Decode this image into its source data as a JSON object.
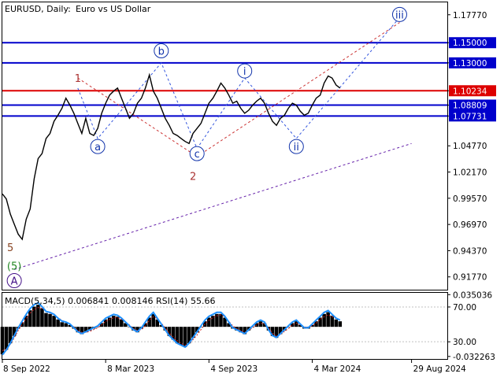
{
  "header": {
    "symbol": "EURUSD, Daily:",
    "description": "Euro vs US Dollar"
  },
  "chart_data": {
    "type": "line",
    "price_axis": {
      "ticks": [
        "1.17770",
        "1.15000",
        "1.13000",
        "1.10234",
        "1.08809",
        "1.07731",
        "1.04770",
        "1.02170",
        "0.99570",
        "0.96970",
        "0.94370",
        "0.91770"
      ],
      "tick_values": [
        1.1777,
        1.15,
        1.13,
        1.10234,
        1.08809,
        1.07731,
        1.0477,
        1.0217,
        0.9957,
        0.9697,
        0.9437,
        0.9177
      ],
      "ylim": [
        0.905,
        1.19
      ]
    },
    "levels": [
      {
        "label": "1.15000",
        "value": 1.15,
        "color": "#0000cc"
      },
      {
        "label": "1.13000",
        "value": 1.13,
        "color": "#0000cc"
      },
      {
        "label": "1.10234",
        "value": 1.10234,
        "color": "#dd0000"
      },
      {
        "label": "1.08809",
        "value": 1.08809,
        "color": "#0000cc"
      },
      {
        "label": "1.07731",
        "value": 1.07731,
        "color": "#0000cc"
      }
    ],
    "current_price": "1.10234",
    "time_axis": {
      "labels": [
        "8 Sep 2022",
        "8 Mar 2023",
        "4 Sep 2023",
        "4 Mar 2024",
        "29 Aug 2024"
      ],
      "label_index": [
        0,
        26,
        52,
        78,
        103
      ],
      "range_index": [
        0,
        112
      ]
    },
    "price_series": {
      "note_units": "weekly close approximations, index = weeks since 8 Sep 2022",
      "values": [
        1.0,
        0.995,
        0.98,
        0.97,
        0.96,
        0.955,
        0.975,
        0.985,
        1.015,
        1.035,
        1.04,
        1.055,
        1.06,
        1.072,
        1.078,
        1.085,
        1.095,
        1.088,
        1.08,
        1.07,
        1.06,
        1.075,
        1.06,
        1.058,
        1.065,
        1.08,
        1.09,
        1.098,
        1.102,
        1.105,
        1.095,
        1.085,
        1.075,
        1.08,
        1.09,
        1.095,
        1.105,
        1.118,
        1.102,
        1.095,
        1.085,
        1.075,
        1.068,
        1.06,
        1.058,
        1.055,
        1.052,
        1.05,
        1.06,
        1.065,
        1.07,
        1.08,
        1.09,
        1.095,
        1.102,
        1.11,
        1.105,
        1.098,
        1.09,
        1.092,
        1.085,
        1.08,
        1.083,
        1.088,
        1.092,
        1.095,
        1.09,
        1.08,
        1.072,
        1.068,
        1.075,
        1.078,
        1.085,
        1.09,
        1.088,
        1.082,
        1.078,
        1.08,
        1.088,
        1.095,
        1.098,
        1.11,
        1.117,
        1.115,
        1.108,
        1.105
      ]
    },
    "wave_labels": [
      {
        "text": "1",
        "x": 19,
        "y": 1.115,
        "color": "#aa3333",
        "circle": false
      },
      {
        "text": "2",
        "x": 48,
        "y": 1.018,
        "color": "#aa3333",
        "circle": false
      },
      {
        "text": "5",
        "x": 2,
        "y": 0.947,
        "color": "#884422",
        "circle": false
      },
      {
        "text": "(5)",
        "x": 3,
        "y": 0.929,
        "color": "#228822",
        "circle": false
      },
      {
        "text": "A",
        "x": 3,
        "y": 0.914,
        "color": "#441188",
        "circle": true
      },
      {
        "text": "a",
        "x": 24,
        "y": 1.047,
        "color": "#1133aa",
        "circle": true
      },
      {
        "text": "b",
        "x": 40,
        "y": 1.142,
        "color": "#1133aa",
        "circle": true
      },
      {
        "text": "c",
        "x": 49,
        "y": 1.04,
        "color": "#1133aa",
        "circle": true
      },
      {
        "text": "i",
        "x": 61,
        "y": 1.122,
        "color": "#1133aa",
        "circle": true
      },
      {
        "text": "ii",
        "x": 74,
        "y": 1.047,
        "color": "#1133aa",
        "circle": true
      },
      {
        "text": "iii",
        "x": 100,
        "y": 1.178,
        "color": "#1133aa",
        "circle": true
      }
    ],
    "wave_lines": [
      {
        "points": [
          [
            19,
            1.115
          ],
          [
            49,
            1.037
          ]
        ],
        "color": "#cc3333",
        "dash": true
      },
      {
        "points": [
          [
            49,
            1.037
          ],
          [
            100,
            1.17
          ]
        ],
        "color": "#cc3333",
        "dash": true
      },
      {
        "points": [
          [
            19,
            1.105
          ],
          [
            24,
            1.055
          ],
          [
            40,
            1.13
          ],
          [
            49,
            1.045
          ],
          [
            61,
            1.115
          ],
          [
            74,
            1.055
          ],
          [
            100,
            1.175
          ]
        ],
        "color": "#3355dd",
        "dash": true
      },
      {
        "points": [
          [
            3,
            0.925
          ],
          [
            103,
            1.05
          ]
        ],
        "color": "#6622aa",
        "dash": true
      }
    ]
  },
  "indicator": {
    "title": "MACD(5,34,5) 0.006841 0.008146 RSI(14) 55.66",
    "ticks": [
      "0.035036",
      "70.00",
      "30.00",
      "-0.032263"
    ],
    "ylim": [
      -0.035,
      0.037
    ],
    "histogram": [
      -0.03,
      -0.025,
      -0.018,
      -0.01,
      -0.002,
      0.005,
      0.012,
      0.018,
      0.022,
      0.024,
      0.02,
      0.015,
      0.014,
      0.012,
      0.008,
      0.005,
      0.004,
      0.002,
      -0.002,
      -0.006,
      -0.008,
      -0.006,
      -0.004,
      -0.002,
      0.0,
      0.004,
      0.008,
      0.01,
      0.012,
      0.011,
      0.008,
      0.004,
      0.0,
      -0.004,
      -0.006,
      -0.002,
      0.004,
      0.01,
      0.014,
      0.008,
      0.002,
      -0.004,
      -0.01,
      -0.014,
      -0.018,
      -0.02,
      -0.022,
      -0.018,
      -0.012,
      -0.006,
      0.0,
      0.006,
      0.01,
      0.012,
      0.014,
      0.014,
      0.01,
      0.004,
      -0.002,
      -0.004,
      -0.006,
      -0.008,
      -0.004,
      0.0,
      0.004,
      0.006,
      0.004,
      -0.004,
      -0.01,
      -0.012,
      -0.008,
      -0.004,
      0.0,
      0.004,
      0.006,
      0.002,
      -0.002,
      -0.002,
      0.002,
      0.006,
      0.01,
      0.014,
      0.016,
      0.012,
      0.008,
      0.006
    ],
    "signal": [
      -0.026,
      -0.024,
      -0.019,
      -0.012,
      -0.004,
      0.003,
      0.009,
      0.015,
      0.019,
      0.021,
      0.02,
      0.017,
      0.015,
      0.013,
      0.01,
      0.007,
      0.005,
      0.003,
      0.0,
      -0.004,
      -0.006,
      -0.006,
      -0.005,
      -0.003,
      -0.001,
      0.002,
      0.006,
      0.008,
      0.01,
      0.01,
      0.008,
      0.005,
      0.002,
      -0.002,
      -0.004,
      -0.003,
      0.001,
      0.007,
      0.011,
      0.009,
      0.004,
      -0.001,
      -0.007,
      -0.011,
      -0.015,
      -0.018,
      -0.02,
      -0.018,
      -0.014,
      -0.009,
      -0.003,
      0.003,
      0.007,
      0.01,
      0.012,
      0.013,
      0.011,
      0.006,
      0.001,
      -0.002,
      -0.004,
      -0.006,
      -0.004,
      -0.001,
      0.002,
      0.004,
      0.003,
      -0.001,
      -0.007,
      -0.01,
      -0.008,
      -0.005,
      -0.002,
      0.002,
      0.004,
      0.002,
      0.0,
      -0.001,
      0.001,
      0.004,
      0.008,
      0.011,
      0.013,
      0.011,
      0.009,
      0.008
    ]
  },
  "colors": {
    "frame": "#000000",
    "grid": "#c0c0c0",
    "price_line": "#000000",
    "rsi_line": "#1e90ff",
    "signal_line": "#cc2222"
  }
}
